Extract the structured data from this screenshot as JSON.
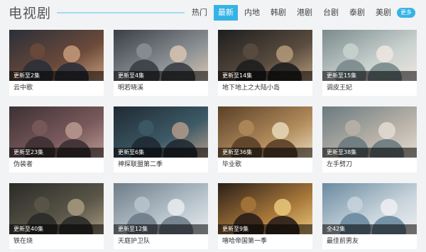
{
  "header": {
    "title": "电视剧",
    "tabs": [
      "热门",
      "最新",
      "内地",
      "韩剧",
      "港剧",
      "台剧",
      "泰剧",
      "美剧"
    ],
    "active_tab": "最新",
    "more_label": "更多"
  },
  "colors": {
    "accent": "#35b3e6",
    "title_line": "#9fdcef"
  },
  "shows": [
    {
      "title": "云中歌",
      "episodes": "更新至2集",
      "palette": [
        "#2b2f3a",
        "#6b4a3a",
        "#c79a7a"
      ]
    },
    {
      "title": "明若晓溪",
      "episodes": "更新至4集",
      "palette": [
        "#3a3e45",
        "#8a8f94",
        "#d8c4b0"
      ]
    },
    {
      "title": "地下地上之大陆小岛",
      "episodes": "更新至14集",
      "palette": [
        "#1e1e1e",
        "#5a4c3f",
        "#b49a7a"
      ]
    },
    {
      "title": "调皮王妃",
      "episodes": "更新至15集",
      "palette": [
        "#7a8a8c",
        "#c9d2cf",
        "#eee6e0"
      ]
    },
    {
      "title": "伪装者",
      "episodes": "更新至23集",
      "palette": [
        "#3c3033",
        "#7a5a5c",
        "#b89a90"
      ]
    },
    {
      "title": "神探联盟第二季",
      "episodes": "更新至6集",
      "palette": [
        "#1f2a33",
        "#3d5a66",
        "#b39a8a"
      ]
    },
    {
      "title": "毕业歌",
      "episodes": "更新至36集",
      "palette": [
        "#5a4028",
        "#b08a5a",
        "#e8d8b8"
      ]
    },
    {
      "title": "左手劈刀",
      "episodes": "更新至38集",
      "palette": [
        "#6a7a80",
        "#b8b2a8",
        "#e4dcd2"
      ]
    },
    {
      "title": "铁在烧",
      "episodes": "更新至40集",
      "palette": [
        "#2a2a28",
        "#5a5648",
        "#a89a80"
      ]
    },
    {
      "title": "天庭护卫队",
      "episodes": "更新至12集",
      "palette": [
        "#6e7c88",
        "#b8c4cc",
        "#e8ecef"
      ]
    },
    {
      "title": "嘻哈帝国第一季",
      "episodes": "更新至9集",
      "palette": [
        "#2a1e18",
        "#a8783a",
        "#e8c87a"
      ]
    },
    {
      "title": "最佳前男友",
      "episodes": "全42集",
      "palette": [
        "#6a8aa0",
        "#c8d4dc",
        "#eef0f2"
      ]
    }
  ]
}
